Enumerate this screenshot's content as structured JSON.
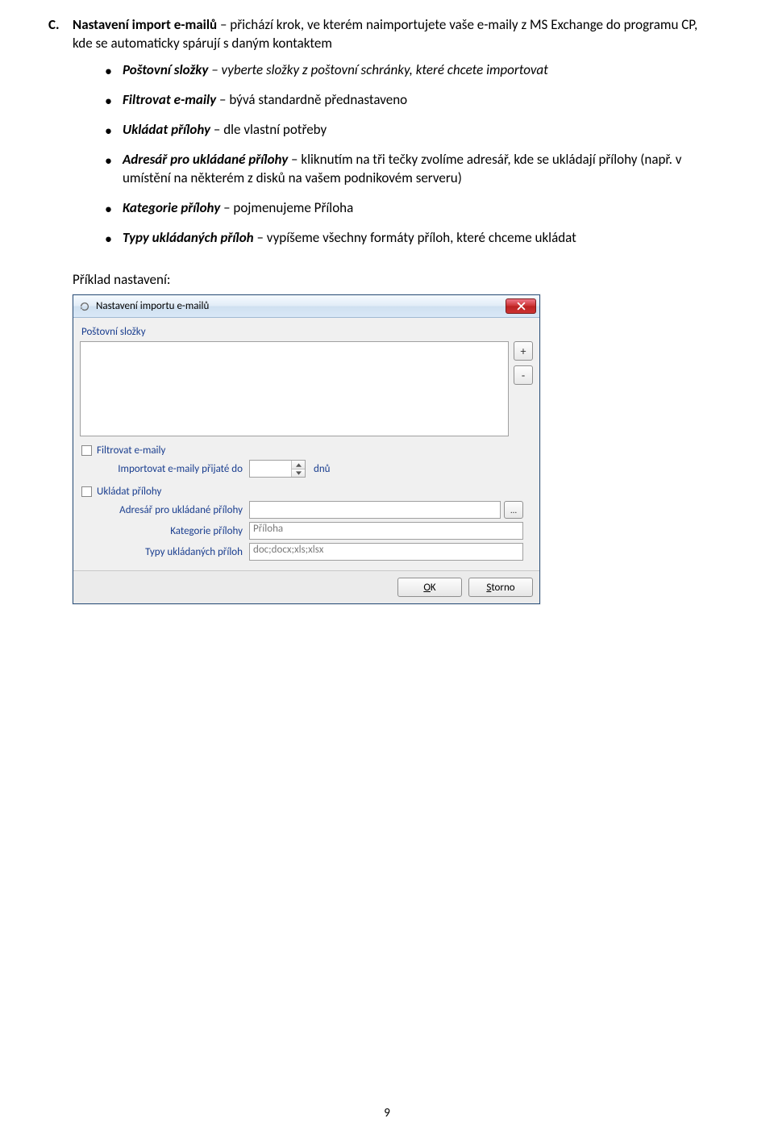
{
  "doc": {
    "section_marker": "C.",
    "heading_bold": "Nastavení import e-mailů",
    "heading_rest": " – přichází krok, ve kterém naimportujete vaše e-maily z MS Exchange do programu CP, kde se automaticky spárují s daným kontaktem",
    "bullets": [
      {
        "term": "Poštovní složky",
        "rest": " – vyberte složky z poštovní schránky, které chcete importovat"
      },
      {
        "term": "Filtrovat e-maily",
        "rest": " – bývá standardně přednastaveno"
      },
      {
        "term": "Ukládat přílohy",
        "rest": " – dle vlastní potřeby"
      },
      {
        "term": "Adresář pro ukládané přílohy",
        "rest": " – kliknutím na tři tečky zvolíme adresář, kde se ukládají přílohy (např. v umístění na některém z disků na vašem podnikovém serveru)"
      },
      {
        "term": "Kategorie přílohy",
        "rest": " – pojmenujeme Příloha"
      },
      {
        "term": "Typy ukládaných příloh",
        "rest": " – vypíšeme všechny formáty příloh, které chceme ukládat"
      }
    ],
    "example_label": "Příklad nastavení:",
    "page_number": "9"
  },
  "dialog": {
    "title": "Nastavení importu e-mailů",
    "section_folders": "Poštovní složky",
    "add_btn": "+",
    "remove_btn": "-",
    "filter_checkbox": "Filtrovat e-maily",
    "import_label": "Importovat e-maily přijaté do",
    "import_value": "",
    "import_unit": "dnů",
    "save_checkbox": "Ukládat přílohy",
    "dir_label": "Adresář pro ukládané přílohy",
    "dir_value": "",
    "browse": "…",
    "category_label": "Kategorie přílohy",
    "category_value": "Příloha",
    "types_label": "Typy ukládaných příloh",
    "types_value": "doc;docx;xls;xlsx",
    "ok_pre": "O",
    "ok_mid": "K",
    "cancel_pre": "S",
    "cancel_rest": "torno"
  }
}
